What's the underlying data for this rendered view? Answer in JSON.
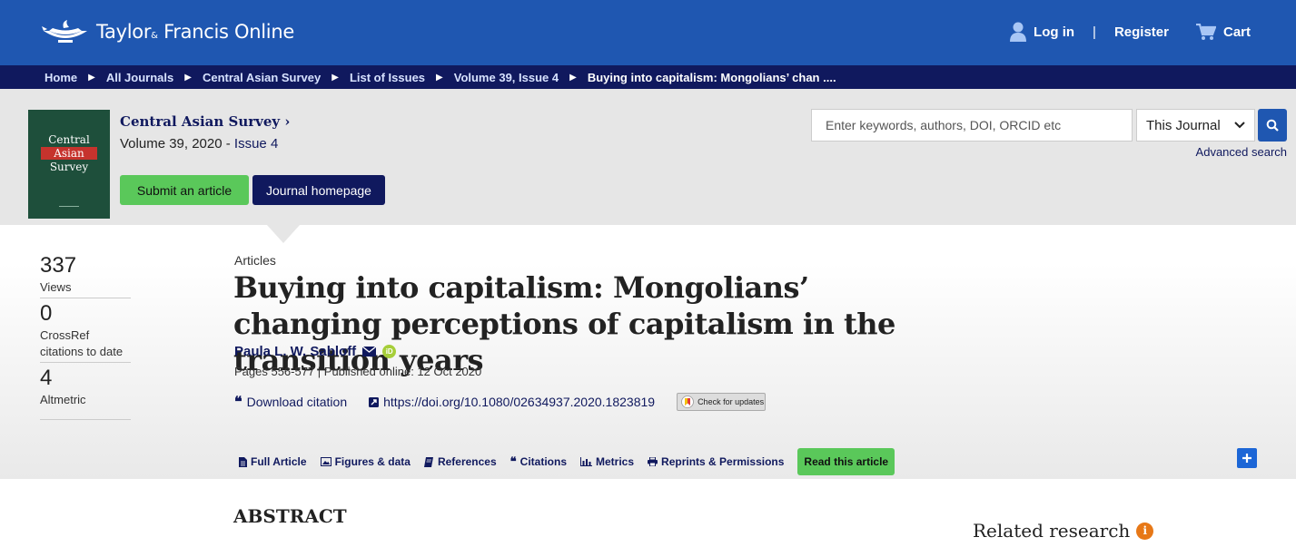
{
  "header": {
    "brand": "Taylor",
    "brand_amp": "&",
    "brand_rest": "Francis Online",
    "login": "Log in",
    "separator": "|",
    "register": "Register",
    "cart": "Cart"
  },
  "breadcrumb": [
    "Home",
    "All Journals",
    "Central Asian Survey",
    "List of Issues",
    "Volume 39, Issue 4",
    "Buying into capitalism: Mongolians’ chan ...."
  ],
  "journal": {
    "cover_lines": [
      "Central",
      "Asian",
      "Survey"
    ],
    "title": "Central Asian Survey",
    "volume_text": "Volume 39, 2020 - ",
    "issue_link": "Issue 4",
    "submit_label": "Submit an article",
    "homepage_label": "Journal homepage"
  },
  "search": {
    "placeholder": "Enter keywords, authors, DOI, ORCID etc",
    "scope": "This Journal",
    "advanced": "Advanced search"
  },
  "metrics": [
    {
      "value": "337",
      "label": "Views"
    },
    {
      "value": "0",
      "label": "CrossRef citations to date"
    },
    {
      "value": "4",
      "label": "Altmetric"
    }
  ],
  "article": {
    "type": "Articles",
    "title": "Buying into capitalism: Mongolians’ changing perceptions of capitalism in the transition years",
    "author": "Paula L. W. Sabloff",
    "pages": "Pages 556-577 | Published online: 12 Oct 2020",
    "download_citation": "Download citation",
    "doi": "https://doi.org/10.1080/02634937.2020.1823819",
    "check_updates": "Check for updates"
  },
  "tabs": [
    {
      "label": "Full Article",
      "icon": "document-icon"
    },
    {
      "label": "Figures & data",
      "icon": "image-icon"
    },
    {
      "label": "References",
      "icon": "book-icon"
    },
    {
      "label": "Citations",
      "icon": "quote-icon"
    },
    {
      "label": "Metrics",
      "icon": "bar-chart-icon"
    },
    {
      "label": "Reprints & Permissions",
      "icon": "print-icon"
    },
    {
      "label": "Read this article",
      "icon": ""
    }
  ],
  "body": {
    "abstract_heading": "ABSTRACT",
    "related_heading": "Related research"
  },
  "colors": {
    "header_blue": "#1f57b1",
    "navy": "#10195e",
    "green": "#5ac85a",
    "orange": "#e77817"
  }
}
